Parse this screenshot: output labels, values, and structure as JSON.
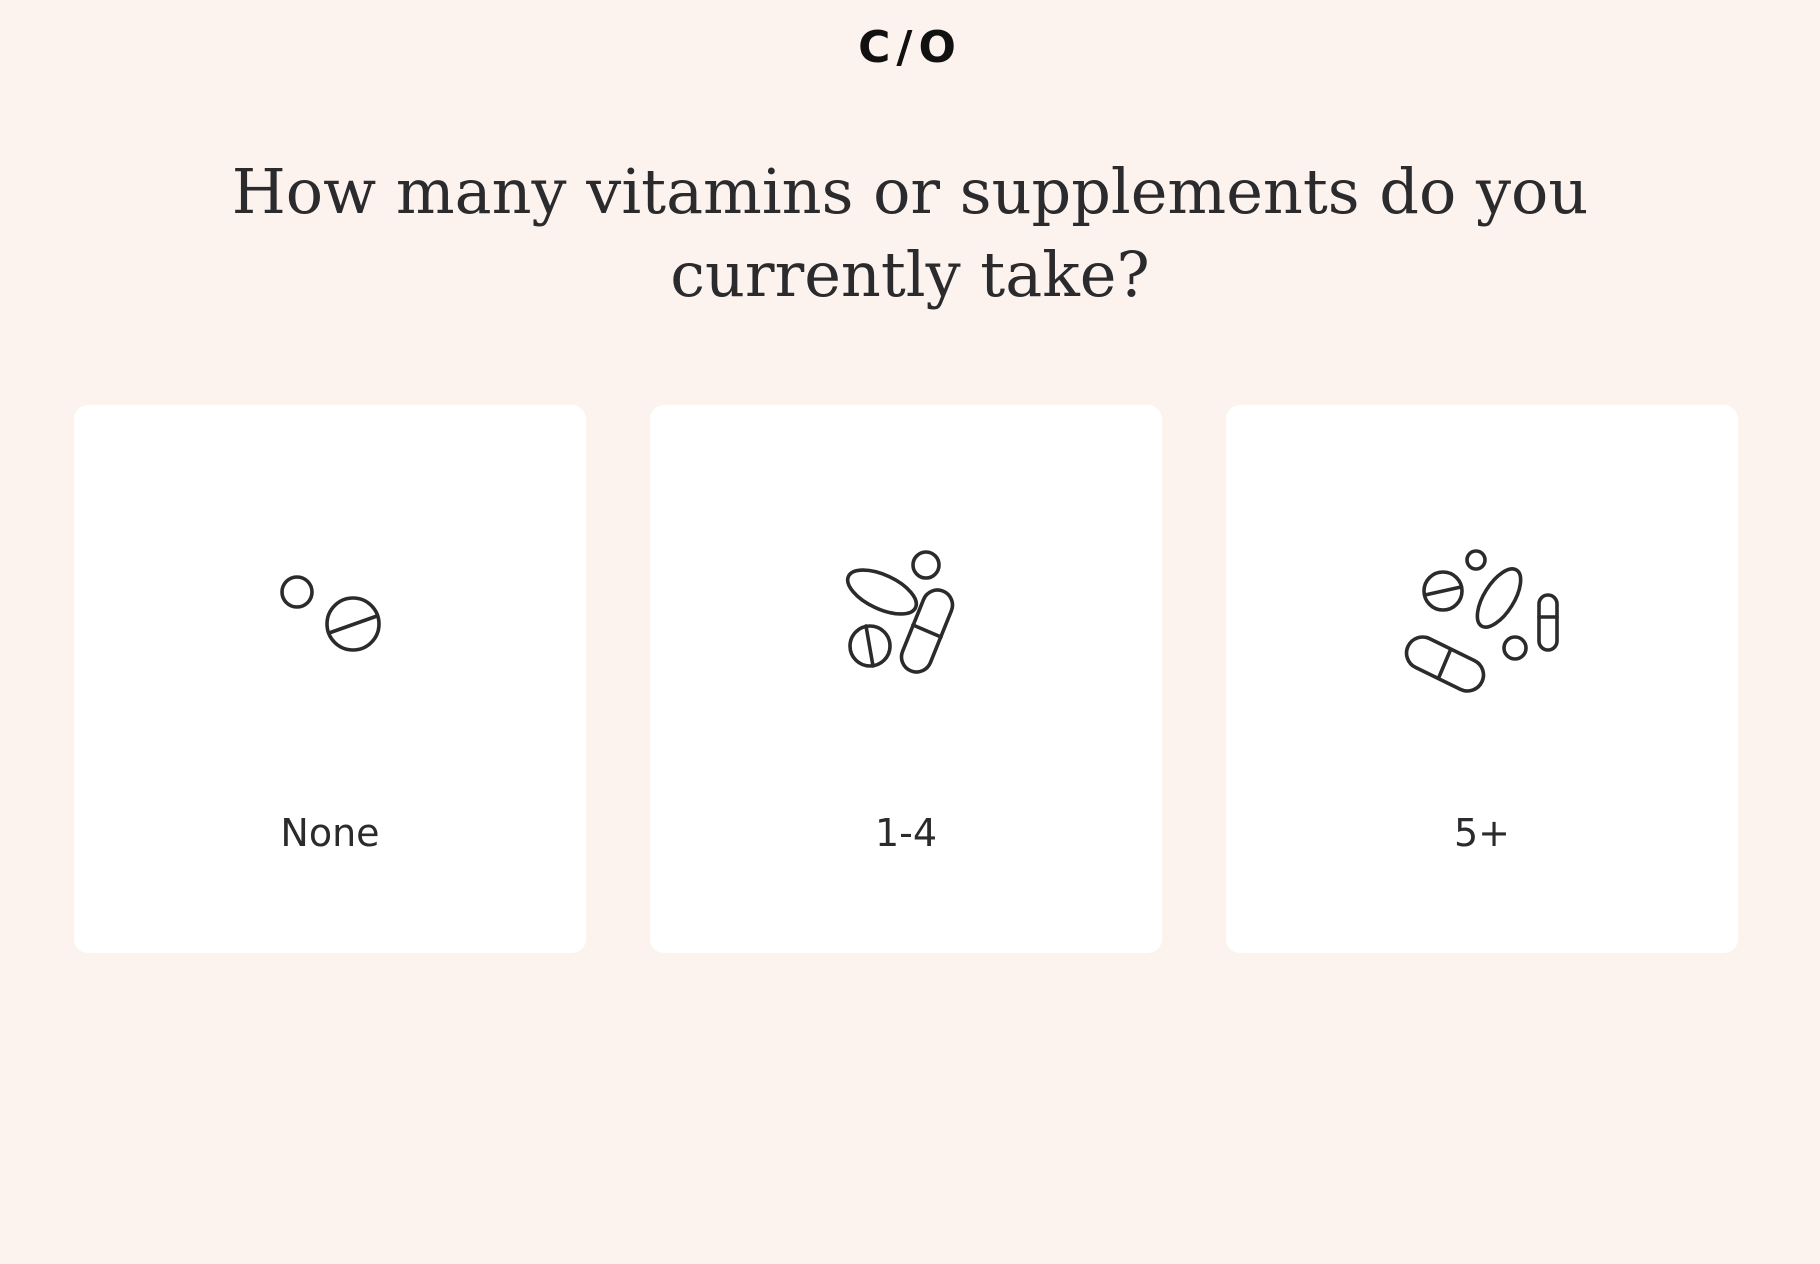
{
  "header": {
    "logo": "C/O"
  },
  "question": {
    "text": "How many vitamins or supplements do you currently take?"
  },
  "options": [
    {
      "label": "None",
      "icon": "few-pills-icon"
    },
    {
      "label": "1-4",
      "icon": "some-pills-icon"
    },
    {
      "label": "5+",
      "icon": "many-pills-icon"
    }
  ],
  "colors": {
    "background": "#fcf3ef",
    "card": "#ffffff",
    "text": "#2b2b2d"
  }
}
